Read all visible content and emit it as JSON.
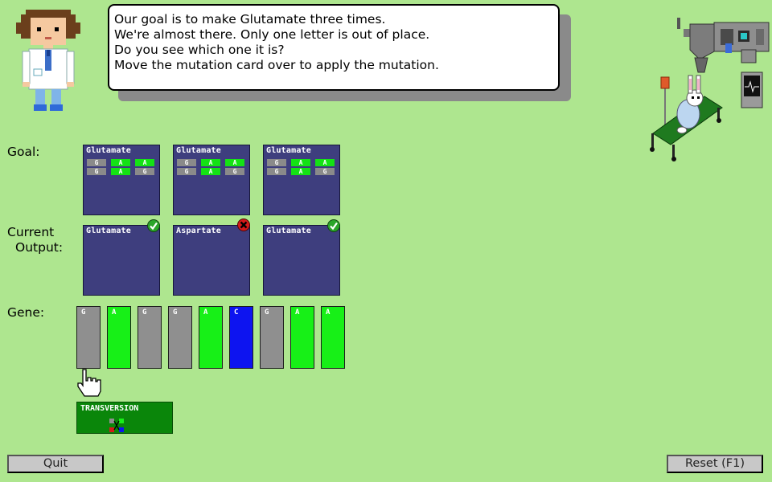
{
  "dialog": {
    "lines": [
      "Our goal is to make Glutamate three times.",
      "We're almost there. Only one letter is out of place.",
      "Do you see which one it is?",
      "Move the mutation card over to apply the mutation."
    ]
  },
  "labels": {
    "goal": "Goal:",
    "current": "Current",
    "output": "Output:",
    "gene": "Gene:"
  },
  "goal_cards": [
    {
      "title": "Glutamate",
      "codons": [
        [
          "G",
          "G"
        ],
        [
          "A",
          "A"
        ],
        [
          "A",
          "G"
        ]
      ]
    },
    {
      "title": "Glutamate",
      "codons": [
        [
          "G",
          "G"
        ],
        [
          "A",
          "A"
        ],
        [
          "A",
          "G"
        ]
      ]
    },
    {
      "title": "Glutamate",
      "codons": [
        [
          "G",
          "G"
        ],
        [
          "A",
          "A"
        ],
        [
          "A",
          "G"
        ]
      ]
    }
  ],
  "output_cards": [
    {
      "title": "Glutamate",
      "status": "correct"
    },
    {
      "title": "Aspartate",
      "status": "wrong"
    },
    {
      "title": "Glutamate",
      "status": "correct"
    }
  ],
  "gene": [
    "G",
    "A",
    "G",
    "G",
    "A",
    "C",
    "G",
    "A",
    "A"
  ],
  "mutation_card": {
    "title": "TRANSVERSION"
  },
  "buttons": {
    "quit": "Quit",
    "reset": "Reset (F1)"
  },
  "colors": {
    "background": "#aee68f",
    "G": "#8f8f8f",
    "A": "#17f017",
    "C": "#0d14f0",
    "card": "#3e3e7e",
    "mutation_card": "#0a860a"
  },
  "icons": {
    "correct": "check-icon",
    "wrong": "x-icon",
    "cursor": "hand-cursor-icon"
  }
}
